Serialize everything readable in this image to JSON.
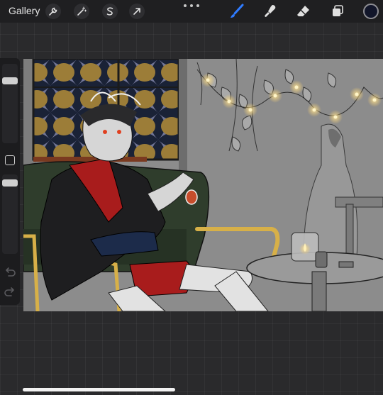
{
  "topbar": {
    "gallery_label": "Gallery",
    "left_tools": [
      {
        "name": "actions",
        "icon": "wrench-icon"
      },
      {
        "name": "adjustments",
        "icon": "magic-wand-icon"
      },
      {
        "name": "selection",
        "icon": "selection-s-icon"
      },
      {
        "name": "transform",
        "icon": "arrow-cursor-icon"
      }
    ],
    "right_tools": [
      {
        "name": "brush",
        "icon": "brush-icon",
        "active": true
      },
      {
        "name": "smudge",
        "icon": "smudge-icon",
        "active": false
      },
      {
        "name": "eraser",
        "icon": "eraser-icon",
        "active": false
      },
      {
        "name": "layers",
        "icon": "layers-icon",
        "active": false
      }
    ],
    "current_color": "#12162a"
  },
  "sidebar": {
    "brush_size_slider": "brush-size",
    "modify_button": "square-icon",
    "opacity_slider": "brush-opacity",
    "undo": "undo-icon",
    "redo": "redo-icon"
  },
  "canvas": {
    "description_icon": "artwork-canvas",
    "accent_active": "#2f7bff"
  }
}
